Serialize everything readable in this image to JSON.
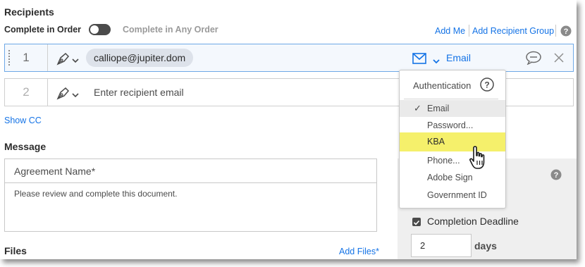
{
  "recipients": {
    "heading": "Recipients",
    "complete_in_order": "Complete in Order",
    "complete_any_order": "Complete in Any Order",
    "add_me": "Add Me",
    "add_group": "Add Recipient Group",
    "rows": [
      {
        "index": "1",
        "email": "calliope@jupiter.dom",
        "auth": "Email"
      },
      {
        "index": "2",
        "placeholder": "Enter recipient email"
      }
    ],
    "show_cc": "Show CC"
  },
  "message": {
    "heading": "Message",
    "agreement_name_placeholder": "Agreement Name*",
    "body": "Please review and complete this document."
  },
  "files": {
    "heading": "Files",
    "add_files": "Add Files*"
  },
  "options": {
    "completion_deadline": "Completion Deadline",
    "days_value": "2",
    "days_label": "days"
  },
  "auth_dropdown": {
    "header": "Authentication",
    "items": [
      "Email",
      "Password...",
      "KBA",
      "Phone...",
      "Adobe Sign",
      "Government ID"
    ],
    "selected": "Email",
    "hovered": "KBA"
  },
  "icons": {
    "role": "pen-signer-icon",
    "auth": "envelope-icon",
    "message": "speech-bubble-icon",
    "remove": "close-icon",
    "help": "help-circle-icon",
    "cursor": "hand-pointer-icon"
  },
  "colors": {
    "link": "#1473e6",
    "highlight": "#f5f06b",
    "active_row_border": "#6ea8e6"
  }
}
